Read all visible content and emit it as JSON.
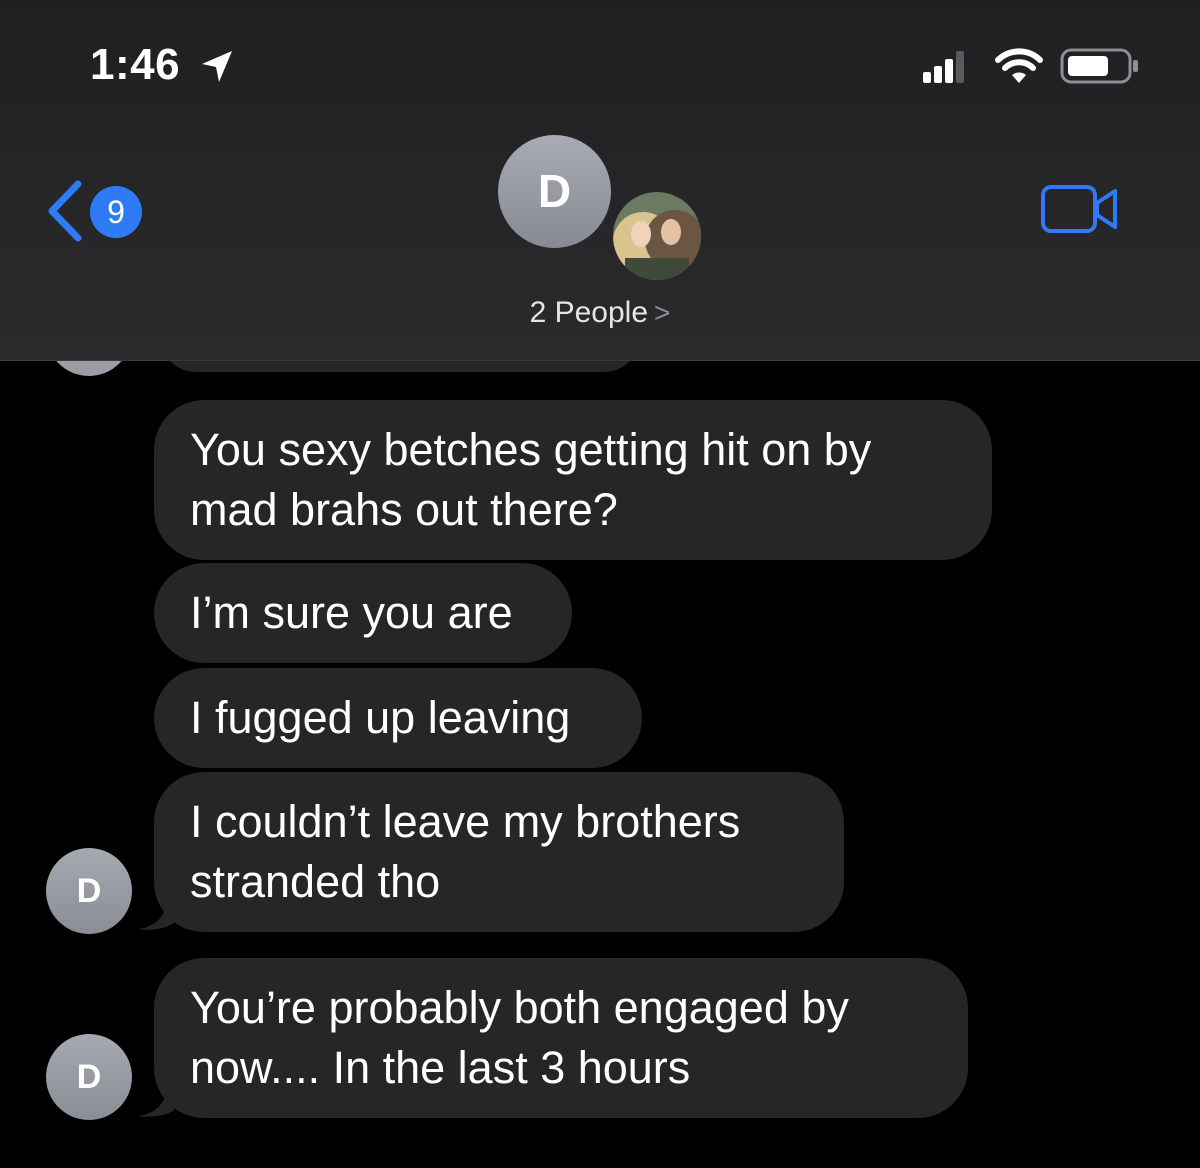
{
  "status_bar": {
    "time": "1:46",
    "icons": [
      "location-arrow-icon",
      "signal-icon",
      "wifi-icon",
      "battery-icon"
    ]
  },
  "header": {
    "back_badge_count": "9",
    "contact_initial": "D",
    "people_label": "2 People",
    "people_chevron": ">",
    "accent_color": "#2f7bf6"
  },
  "messages": [
    {
      "lines": [
        "You sexy betches getting hit on by",
        "mad brahs out there?"
      ]
    },
    {
      "lines": [
        "I’m sure you are"
      ]
    },
    {
      "lines": [
        "I fugged up leaving"
      ]
    },
    {
      "lines": [
        "I couldn’t leave my brothers",
        "stranded tho"
      ],
      "avatar": "D"
    },
    {
      "lines": [
        "You’re probably both engaged by",
        "now.... In the last 3 hours"
      ],
      "avatar": "D"
    }
  ],
  "colors": {
    "bubble": "#262628",
    "background": "#000000",
    "avatar": "#9a9da4"
  }
}
